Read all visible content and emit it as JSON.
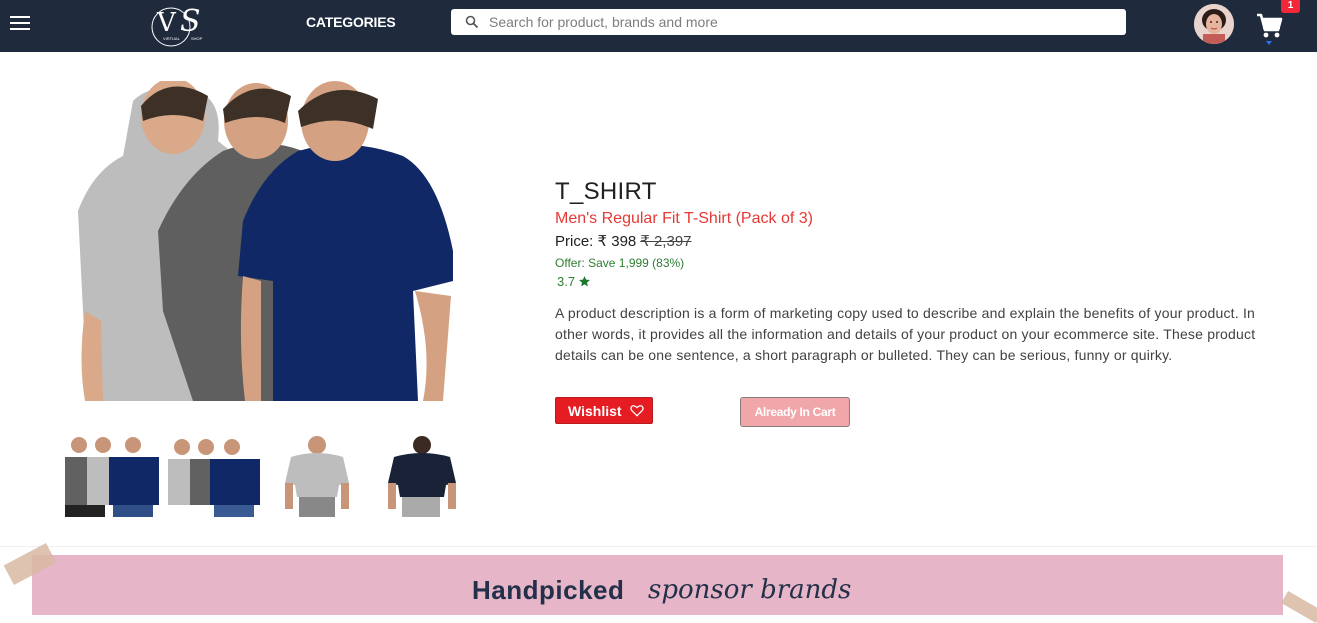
{
  "header": {
    "menu_icon": "hamburger-menu-icon",
    "logo_text": "VS",
    "logo_small_left": "VIRTUAL",
    "logo_small_right": "SHOP",
    "categories_label": "CATEGORIES",
    "search_placeholder": "Search for product, brands and more",
    "search_icon": "search-icon",
    "cart_icon": "cart-icon",
    "cart_count": "1"
  },
  "product": {
    "title": "T_SHIRT",
    "subtitle": "Men's Regular Fit T-Shirt (Pack of 3)",
    "price_label": "Price: ₹ 398",
    "price_old": "₹ 2,397",
    "offer": "Offer: Save 1,999 (83%)",
    "rating": "3.7",
    "description": "A product description is a form of marketing copy used to describe and explain the benefits of your product. In other words, it provides all the information and details of your product on your ecommerce site. These product details can be one sentence, a short paragraph or bulleted. They can be serious, funny or quirky.",
    "wishlist_label": "Wishlist",
    "incart_label": "Already In Cart"
  },
  "banner": {
    "title_bold": "Handpicked",
    "title_script": "sponsor brands"
  },
  "colors": {
    "header_bg": "#1f2a3d",
    "accent_red": "#e51d22",
    "offer_green": "#2e7d32",
    "banner_pink": "#e6b5c7"
  }
}
